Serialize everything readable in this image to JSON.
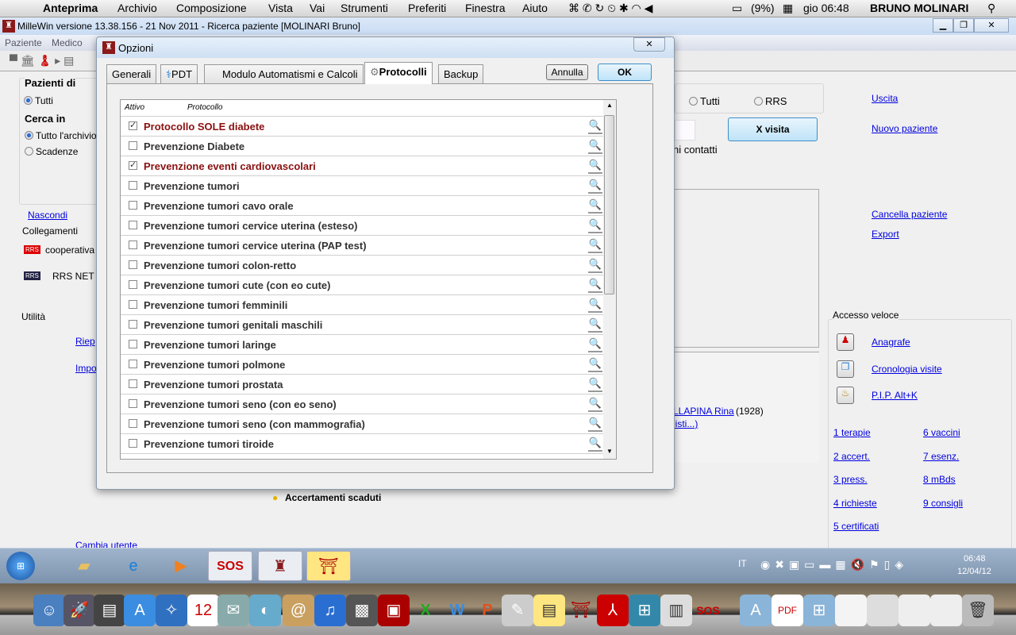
{
  "mac_menubar": {
    "app": "Anteprima",
    "items": [
      "Archivio",
      "Composizione",
      "Vista",
      "Vai",
      "Strumenti",
      "Preferiti",
      "Finestra",
      "Aiuto"
    ],
    "battery": "(9%)",
    "clock": "gio 06:48",
    "user": "BRUNO MOLINARI"
  },
  "window": {
    "title": "MilleWin versione 13.38.156 - 21 Nov 2011 - Ricerca paziente [MOLINARI Bruno]",
    "menu": [
      "Paziente",
      "Medico"
    ]
  },
  "background": {
    "pazienti_di": "Pazienti di",
    "tutti": "Tutti",
    "cerca_in": "Cerca in",
    "tutto_archivio": "Tutto l'archivio",
    "scadenze": "Scadenze",
    "nascondi": "Nascondi",
    "collegamenti": "Collegamenti",
    "rrs_badge": "RRS",
    "cooperativa": "cooperativa",
    "rrs_net": "RRS NET",
    "utilita": "Utilità",
    "riep": "Riep",
    "impo": "Impo",
    "cambia_utente": "Cambia utente",
    "radio_tutti": "Tutti",
    "radio_rrs": "RRS",
    "x_visita": "X visita",
    "contatti": "ni contatti",
    "uscita": "Uscita",
    "nuovo_paziente": "Nuovo paziente",
    "cancella_paziente": "Cancella paziente",
    "export": "Export",
    "accesso_veloce": "Accesso veloce",
    "anagrafe": "Anagrafe",
    "cronologia": "Cronologia visite",
    "pip": "P.I.P. Alt+K",
    "patient_link": "LLAPINA Rina",
    "patient_year": "(1928)",
    "listi": "listi...)",
    "accertamenti": "Accertamenti scaduti",
    "quick_links": [
      "1 terapie",
      "2 accert.",
      "3 press.",
      "4 richieste",
      "5 certificati",
      "6 vaccini",
      "7 esenz.",
      "8 mBds",
      "9 consigli"
    ]
  },
  "dialog": {
    "title": "Opzioni",
    "tabs": [
      "Generali",
      "PDT",
      "Modulo Automatismi e Calcoli",
      "Protocolli",
      "Backup"
    ],
    "active_tab": "Protocolli",
    "cancel": "Annulla",
    "ok": "OK",
    "columns": [
      "Attivo",
      "Protocollo"
    ],
    "rows": [
      {
        "label": "Protocollo SOLE diabete",
        "checked": true
      },
      {
        "label": "Prevenzione Diabete",
        "checked": false
      },
      {
        "label": "Prevenzione eventi cardiovascolari",
        "checked": true
      },
      {
        "label": "Prevenzione tumori",
        "checked": false
      },
      {
        "label": "Prevenzione tumori cavo orale",
        "checked": false
      },
      {
        "label": "Prevenzione tumori cervice uterina (esteso)",
        "checked": false
      },
      {
        "label": "Prevenzione tumori cervice uterina (PAP test)",
        "checked": false
      },
      {
        "label": "Prevenzione tumori colon-retto",
        "checked": false
      },
      {
        "label": "Prevenzione tumori cute (con eo cute)",
        "checked": false
      },
      {
        "label": "Prevenzione tumori femminili",
        "checked": false
      },
      {
        "label": "Prevenzione tumori genitali maschili",
        "checked": false
      },
      {
        "label": "Prevenzione tumori laringe",
        "checked": false
      },
      {
        "label": "Prevenzione tumori polmone",
        "checked": false
      },
      {
        "label": "Prevenzione tumori prostata",
        "checked": false
      },
      {
        "label": "Prevenzione tumori seno (con eo seno)",
        "checked": false
      },
      {
        "label": "Prevenzione tumori seno (con mammografia)",
        "checked": false
      },
      {
        "label": "Prevenzione tumori tiroide",
        "checked": false
      }
    ]
  },
  "taskbar": {
    "lang": "IT",
    "time": "06:48",
    "date": "12/04/12"
  },
  "colors": {
    "checked_text": "#8b1010",
    "link": "#0000e0",
    "accent": "#2a6ed1"
  }
}
